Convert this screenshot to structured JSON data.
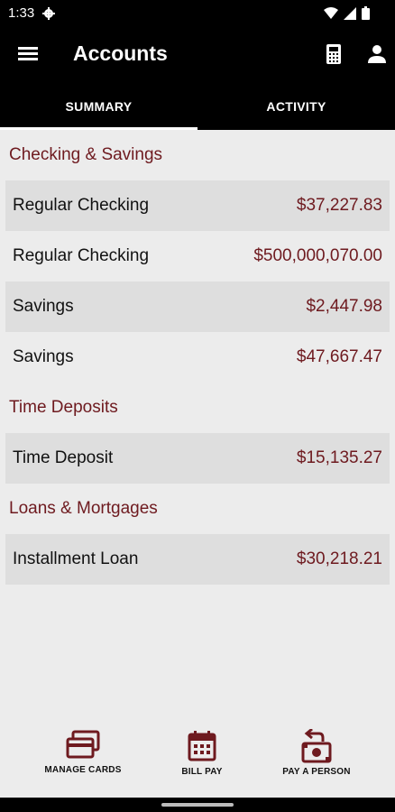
{
  "status_bar": {
    "time": "1:33"
  },
  "app_bar": {
    "title": "Accounts"
  },
  "tabs": [
    {
      "label": "SUMMARY",
      "active": true
    },
    {
      "label": "ACTIVITY",
      "active": false
    }
  ],
  "sections": [
    {
      "title": "Checking & Savings",
      "accounts": [
        {
          "name": "Regular Checking",
          "amount": "$37,227.83"
        },
        {
          "name": "Regular Checking",
          "amount": "$500,000,070.00"
        },
        {
          "name": "Savings",
          "amount": "$2,447.98"
        },
        {
          "name": "Savings",
          "amount": "$47,667.47"
        }
      ]
    },
    {
      "title": "Time Deposits",
      "accounts": [
        {
          "name": "Time Deposit",
          "amount": "$15,135.27"
        }
      ]
    },
    {
      "title": "Loans & Mortgages",
      "accounts": [
        {
          "name": "Installment Loan",
          "amount": "$30,218.21"
        }
      ]
    }
  ],
  "bottom_nav": [
    {
      "label": "MANAGE CARDS",
      "icon": "credit-card-icon"
    },
    {
      "label": "BILL PAY",
      "icon": "calendar-icon"
    },
    {
      "label": "PAY A PERSON",
      "icon": "money-transfer-icon"
    }
  ],
  "colors": {
    "accent": "#6e1a1f",
    "bar": "#000000",
    "background": "#ececec",
    "row_shade": "#dedede"
  }
}
